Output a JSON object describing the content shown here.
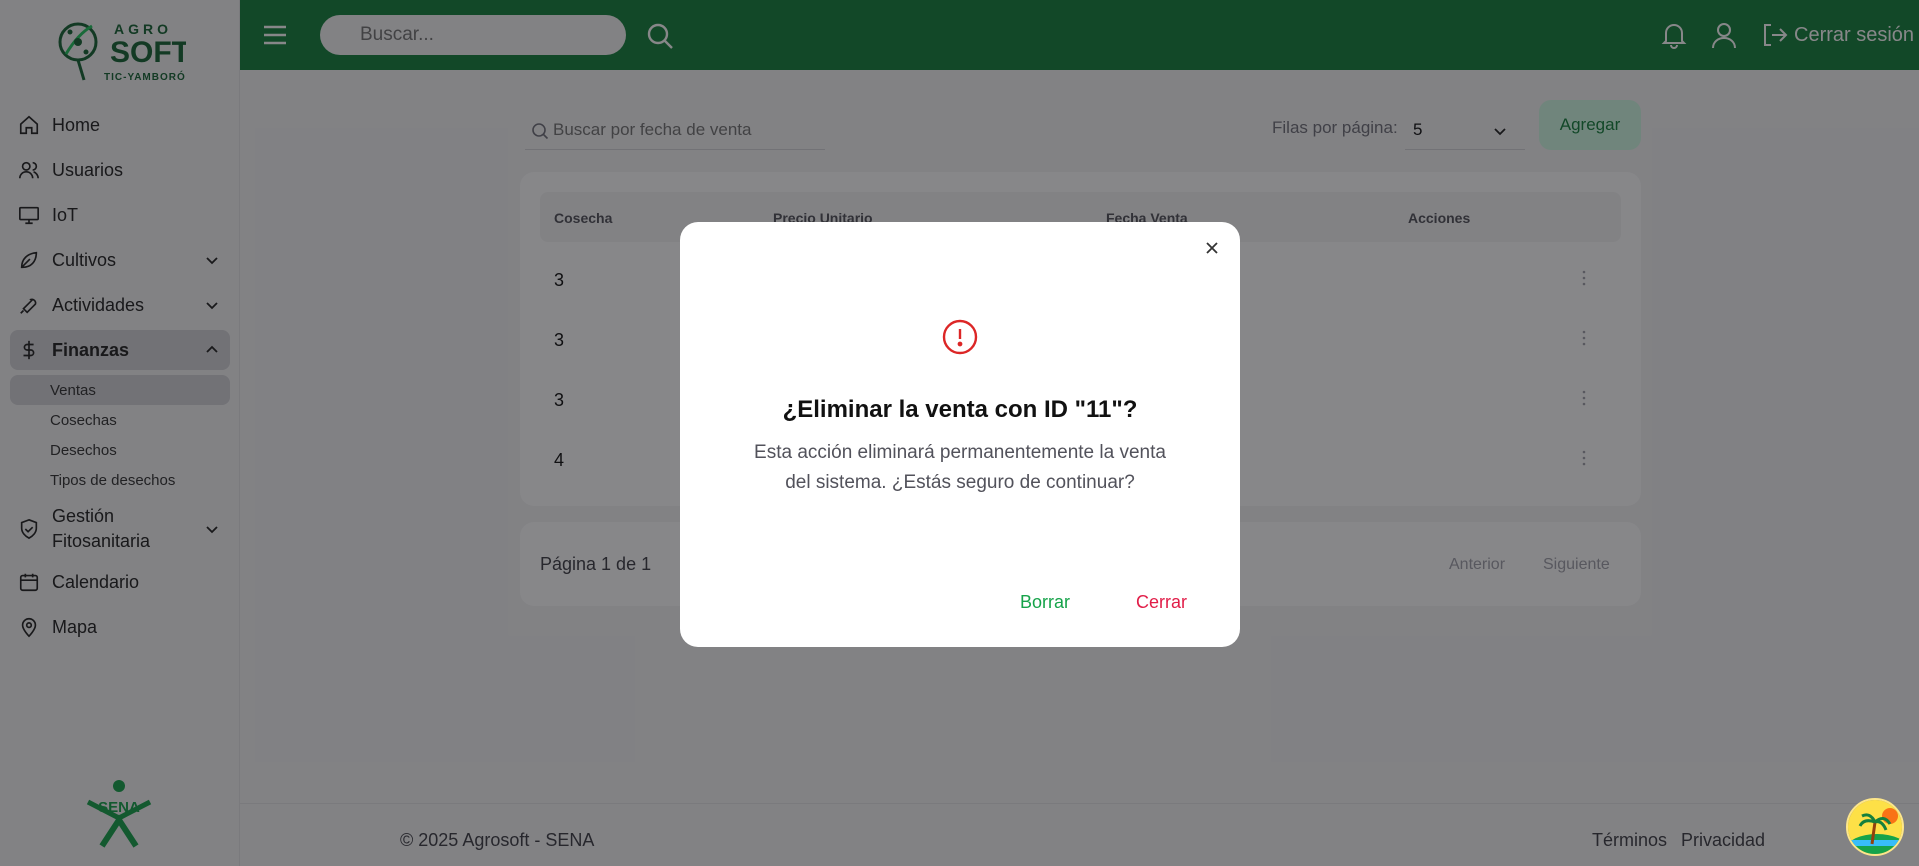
{
  "brand": {
    "logo_top": "AGRO",
    "logo_main": "SOFT",
    "logo_sub": "TIC-YAMBORÓ",
    "sena_label": "SENA",
    "primary_color": "#15803d"
  },
  "sidebar": {
    "items": [
      {
        "label": "Home",
        "icon": "home-icon"
      },
      {
        "label": "Usuarios",
        "icon": "users-icon"
      },
      {
        "label": "IoT",
        "icon": "monitor-icon"
      },
      {
        "label": "Cultivos",
        "icon": "leaf-icon"
      },
      {
        "label": "Actividades",
        "icon": "wrench-icon"
      },
      {
        "label": "Finanzas",
        "icon": "dollar-icon"
      },
      {
        "label": "Gestión Fitosanitaria",
        "icon": "shield-check-icon"
      },
      {
        "label": "Calendario",
        "icon": "calendar-icon"
      },
      {
        "label": "Mapa",
        "icon": "map-pin-icon"
      }
    ],
    "finanzas_sub": [
      "Ventas",
      "Cosechas",
      "Desechos",
      "Tipos de desechos"
    ],
    "active_sub": "Ventas"
  },
  "topbar": {
    "search_placeholder": "Buscar...",
    "logout_label": "Cerrar sesión"
  },
  "toolbar": {
    "search_placeholder": "Buscar por fecha de venta",
    "rows_label": "Filas por página:",
    "rows_value": "5",
    "add_label": "Agregar"
  },
  "table": {
    "headers": [
      "Cosecha",
      "Precio Unitario",
      "Fecha Venta",
      "Acciones"
    ],
    "rows": [
      "3",
      "3",
      "3",
      "4"
    ]
  },
  "pager": {
    "text": "Página 1 de 1",
    "prev": "Anterior",
    "next": "Siguiente"
  },
  "footer": {
    "copy": "© 2025 Agrosoft - SENA",
    "terms": "Términos",
    "privacy": "Privacidad"
  },
  "modal": {
    "title": "¿Eliminar la venta con ID \"11\"?",
    "description": "Esta acción eliminará permanentemente la venta del sistema. ¿Estás seguro de continuar?",
    "confirm_label": "Borrar",
    "cancel_label": "Cerrar",
    "confirm_color": "#16a34a",
    "cancel_color": "#e11d48"
  }
}
